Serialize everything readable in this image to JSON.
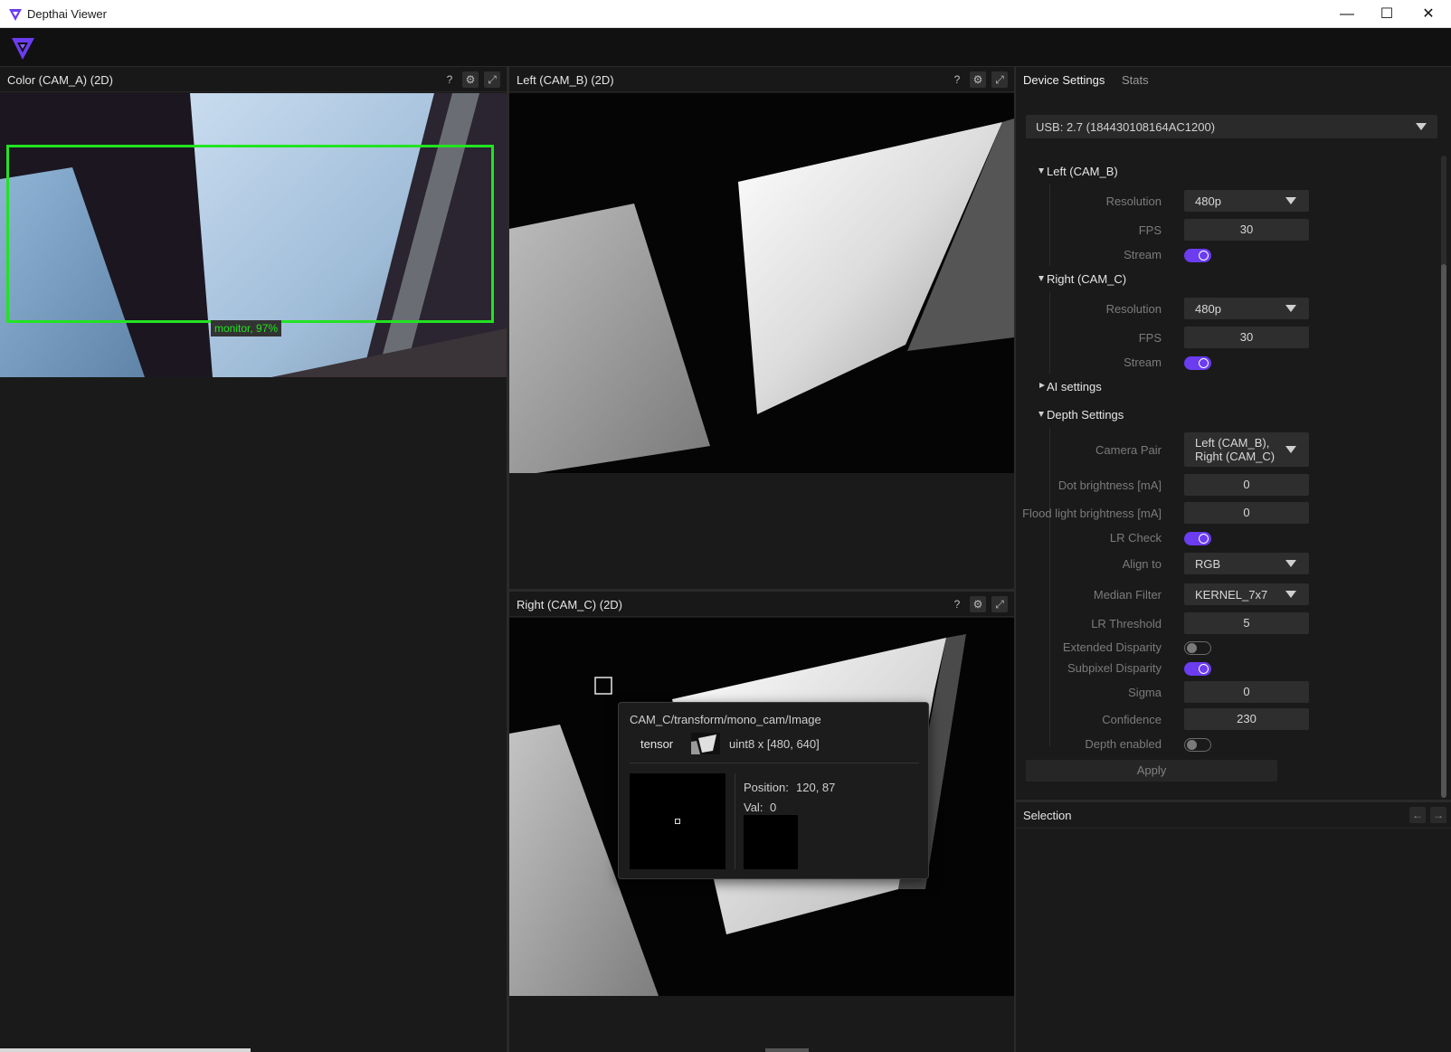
{
  "window": {
    "title": "Depthai Viewer",
    "minimize": "—",
    "maximize": "☐",
    "close": "✕"
  },
  "panels": {
    "color": {
      "title": "Color (CAM_A) (2D)"
    },
    "left": {
      "title": "Left (CAM_B) (2D)"
    },
    "right": {
      "title": "Right (CAM_C) (2D)"
    },
    "help_glyph": "?",
    "settings_glyph": "⚙",
    "maximize_glyph": "⤢"
  },
  "detection": {
    "label": "monitor, 97%"
  },
  "tooltip": {
    "path": "CAM_C/transform/mono_cam/Image",
    "kind": "tensor",
    "shape": "uint8 x [480, 640]",
    "position_label": "Position:",
    "position_value": "120, 87",
    "val_label": "Val:",
    "val_value": "0"
  },
  "settings": {
    "tabs": [
      "Device Settings",
      "Stats"
    ],
    "device": "USB: 2.7 (184430108164AC1200)",
    "left_cam": {
      "title": "Left (CAM_B)",
      "resolution_label": "Resolution",
      "resolution": "480p",
      "fps_label": "FPS",
      "fps": "30",
      "stream_label": "Stream",
      "stream": true
    },
    "right_cam": {
      "title": "Right (CAM_C)",
      "resolution_label": "Resolution",
      "resolution": "480p",
      "fps_label": "FPS",
      "fps": "30",
      "stream_label": "Stream",
      "stream": true
    },
    "ai": {
      "title": "AI settings"
    },
    "depth": {
      "title": "Depth Settings",
      "camera_pair_label": "Camera Pair",
      "camera_pair_line1": "Left (CAM_B),",
      "camera_pair_line2": "Right (CAM_C)",
      "dot_label": "Dot brightness [mA]",
      "dot": "0",
      "flood_label": "Flood light brightness [mA]",
      "flood": "0",
      "lr_check_label": "LR Check",
      "lr_check": true,
      "align_label": "Align to",
      "align": "RGB",
      "median_label": "Median Filter",
      "median": "KERNEL_7x7",
      "lr_threshold_label": "LR Threshold",
      "lr_threshold": "5",
      "extended_label": "Extended Disparity",
      "extended": false,
      "subpixel_label": "Subpixel Disparity",
      "subpixel": true,
      "sigma_label": "Sigma",
      "sigma": "0",
      "confidence_label": "Confidence",
      "confidence": "230",
      "depth_enabled_label": "Depth enabled",
      "depth_enabled": false
    },
    "apply": "Apply"
  },
  "selection": {
    "title": "Selection",
    "back": "←",
    "forward": "→"
  },
  "colors": {
    "accent": "#6b3cf0",
    "detection": "#22e322",
    "background": "#1a1a1a"
  }
}
